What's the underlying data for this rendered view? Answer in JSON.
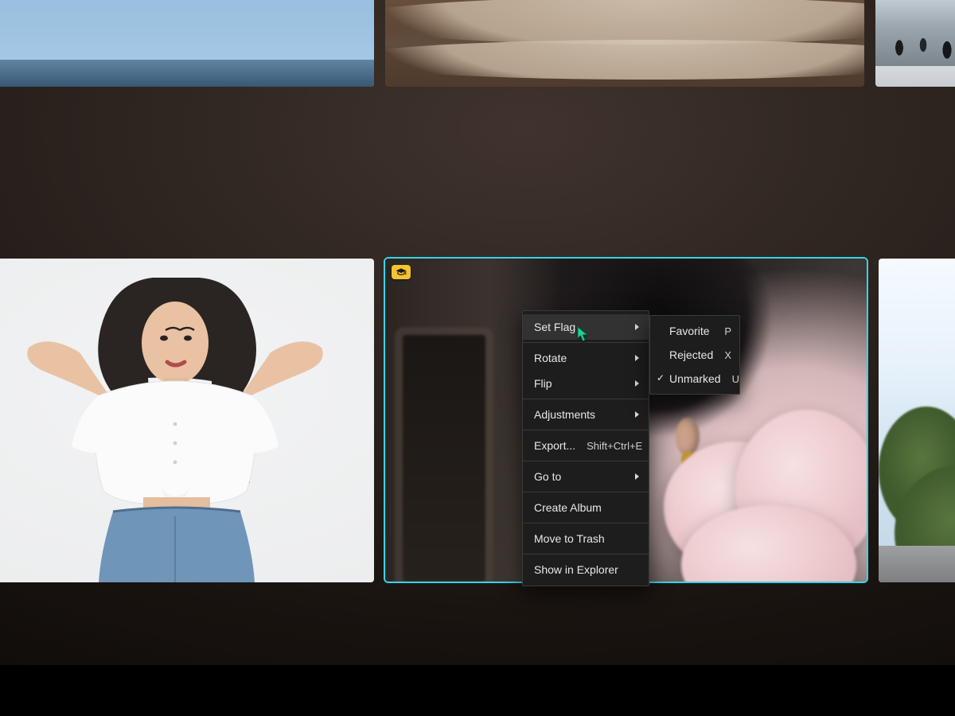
{
  "selection_outline_color": "#37d3e8",
  "grid": {
    "row1": [
      {
        "name": "waterfront-buildings-reflection"
      },
      {
        "name": "beach-waves-sunset"
      },
      {
        "name": "street-crowd"
      }
    ],
    "row2": [
      {
        "name": "portrait-white-top",
        "selected": false
      },
      {
        "name": "portrait-pink-ruffles",
        "selected": true,
        "badge": "graduation-cap-icon"
      },
      {
        "name": "outdoor-trees-sky",
        "selected": false
      }
    ]
  },
  "context_menu": {
    "items": [
      {
        "label": "Set Flag",
        "submenu": true,
        "hover": true
      },
      {
        "sep": true
      },
      {
        "label": "Rotate",
        "submenu": true
      },
      {
        "label": "Flip",
        "submenu": true
      },
      {
        "sep": true
      },
      {
        "label": "Adjustments",
        "submenu": true
      },
      {
        "sep": true
      },
      {
        "label": "Export...",
        "shortcut": "Shift+Ctrl+E"
      },
      {
        "sep": true
      },
      {
        "label": "Go to",
        "submenu": true
      },
      {
        "sep": true
      },
      {
        "label": "Create Album"
      },
      {
        "sep": true
      },
      {
        "label": "Move to Trash"
      },
      {
        "sep": true
      },
      {
        "label": "Show in Explorer"
      }
    ]
  },
  "set_flag_submenu": {
    "items": [
      {
        "label": "Favorite",
        "shortcut": "P",
        "checked": false
      },
      {
        "label": "Rejected",
        "shortcut": "X",
        "checked": false
      },
      {
        "label": "Unmarked",
        "shortcut": "U",
        "checked": true
      }
    ]
  }
}
